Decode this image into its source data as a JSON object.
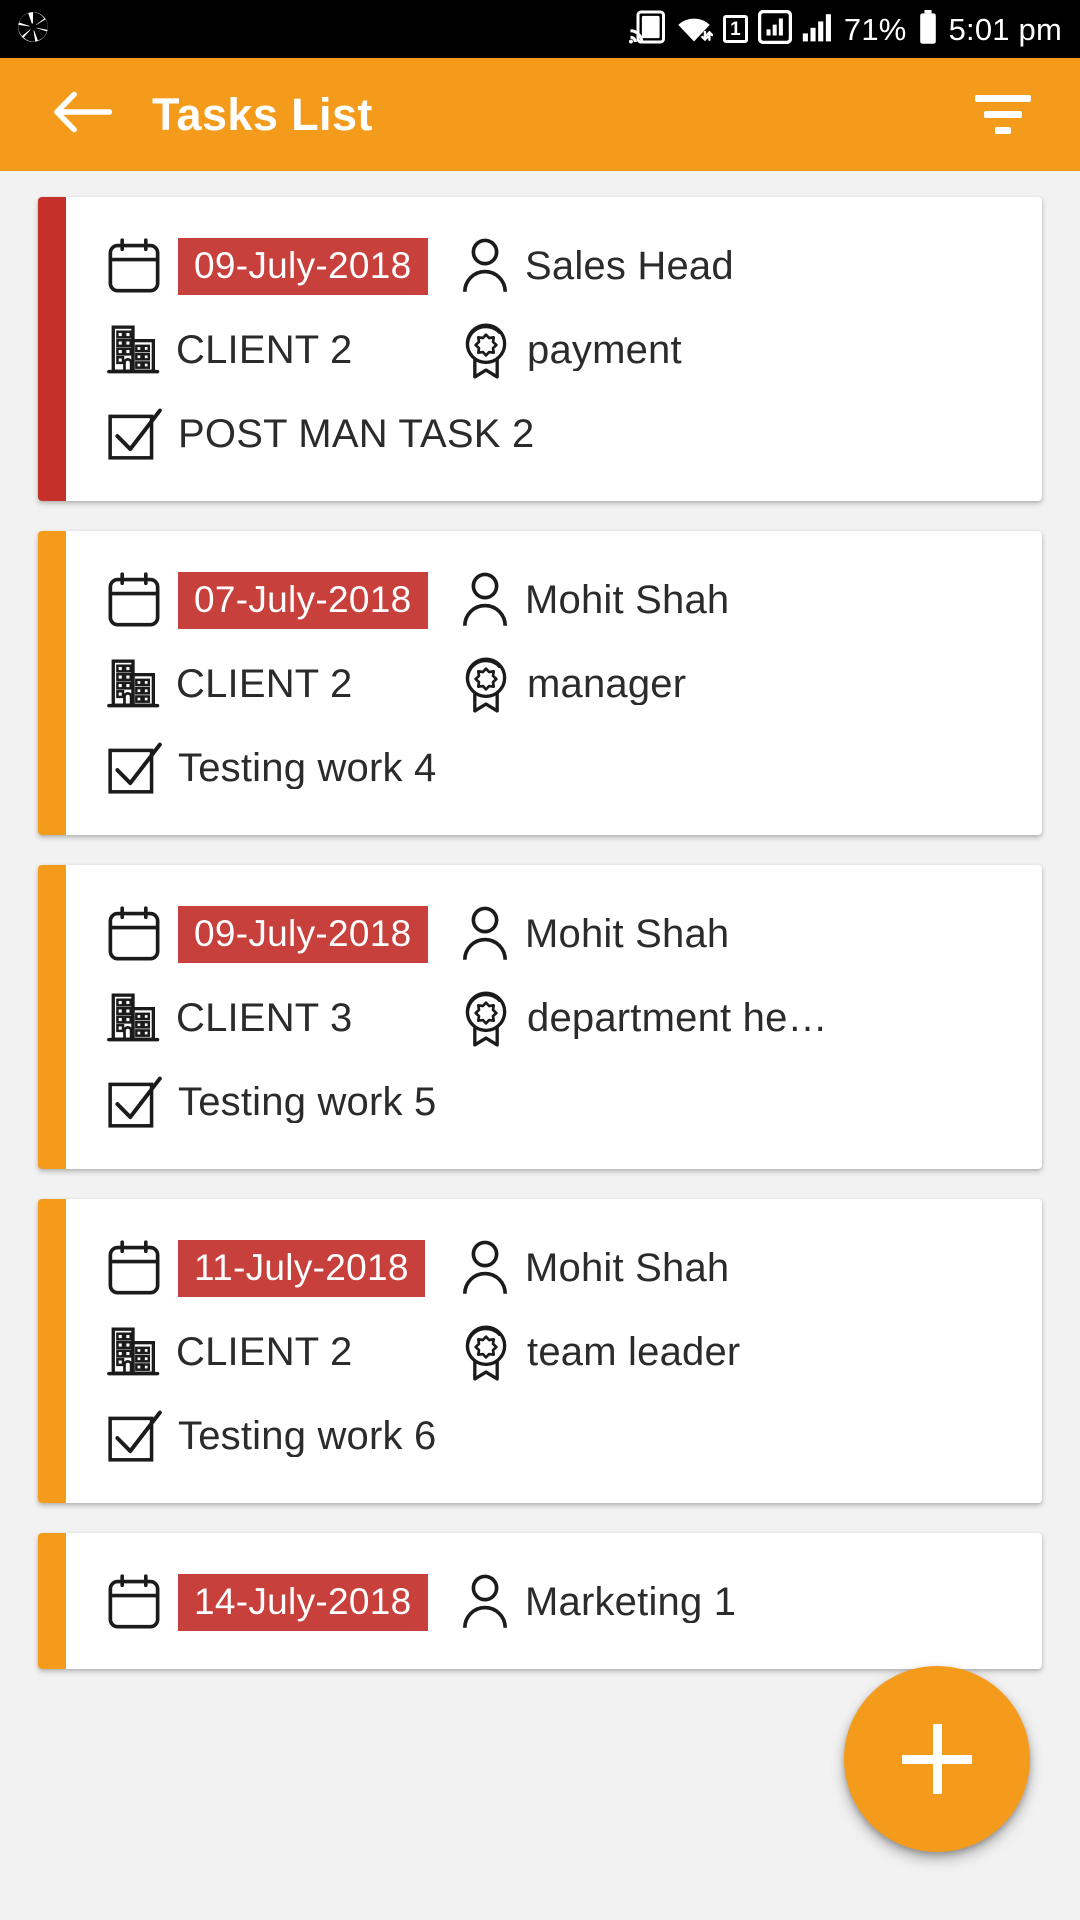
{
  "status_bar": {
    "left_icons": [
      "aperture-icon"
    ],
    "right_icons": [
      "cast-icon",
      "wifi-icon",
      "sim-icon",
      "signal-1-icon",
      "signal-2-icon",
      "battery-icon"
    ],
    "sim_label": "1",
    "battery_percent": "71%",
    "time": "5:01 pm"
  },
  "app_bar": {
    "back_label": "back-arrow",
    "title": "Tasks List",
    "filter_label": "filter"
  },
  "colors": {
    "app_bar": "#F59B1C",
    "accent_orange": "#F59B1C",
    "accent_red": "#C6302B",
    "date_badge": "#C8403C",
    "page_background": "#F2F2F2",
    "card": "#FFFFFF",
    "text": "#2B2B2B"
  },
  "fab": {
    "label": "+",
    "name": "add-task"
  },
  "tasks": [
    {
      "date": "09-July-2018",
      "assignee": "Sales Head",
      "client": "CLIENT 2",
      "role": "payment",
      "title": "POST MAN TASK 2",
      "accent": "#C6302B"
    },
    {
      "date": "07-July-2018",
      "assignee": "Mohit Shah",
      "client": "CLIENT 2",
      "role": "manager",
      "title": "Testing work 4",
      "accent": "#F59B1C"
    },
    {
      "date": "09-July-2018",
      "assignee": "Mohit Shah",
      "client": "CLIENT 3",
      "role": "department he…",
      "title": "Testing work 5",
      "accent": "#F59B1C"
    },
    {
      "date": "11-July-2018",
      "assignee": "Mohit Shah",
      "client": "CLIENT 2",
      "role": "team leader",
      "title": "Testing work 6",
      "accent": "#F59B1C"
    },
    {
      "date": "14-July-2018",
      "assignee": "Marketing 1",
      "client": "",
      "role": "",
      "title": "",
      "accent": "#F59B1C"
    }
  ],
  "icon_names": {
    "date": "calendar-icon",
    "assignee": "person-icon",
    "client": "building-icon",
    "role": "award-icon",
    "title": "checkbox-check-icon"
  }
}
